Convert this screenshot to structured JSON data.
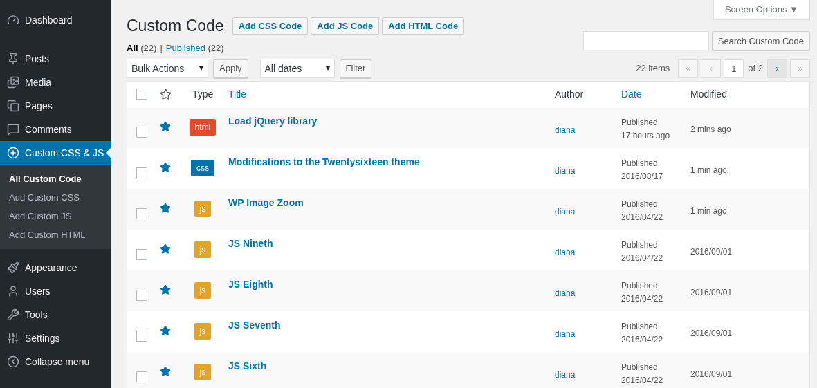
{
  "sidebar": {
    "items": [
      {
        "label": "Dashboard",
        "selected": false
      },
      {
        "label": "Posts",
        "selected": false
      },
      {
        "label": "Media",
        "selected": false
      },
      {
        "label": "Pages",
        "selected": false
      },
      {
        "label": "Comments",
        "selected": false
      },
      {
        "label": "Custom CSS & JS",
        "selected": true,
        "children": [
          {
            "label": "All Custom Code",
            "selected": true
          },
          {
            "label": "Add Custom CSS",
            "selected": false
          },
          {
            "label": "Add Custom JS",
            "selected": false
          },
          {
            "label": "Add Custom HTML",
            "selected": false
          }
        ]
      },
      {
        "label": "Appearance",
        "selected": false
      },
      {
        "label": "Users",
        "selected": false
      },
      {
        "label": "Tools",
        "selected": false
      },
      {
        "label": "Settings",
        "selected": false
      },
      {
        "label": "Collapse menu",
        "selected": false
      }
    ]
  },
  "header": {
    "title": "Custom Code",
    "add_buttons": [
      "Add CSS Code",
      "Add JS Code",
      "Add HTML Code"
    ],
    "screen_options": "Screen Options ▼"
  },
  "views": [
    {
      "label": "All",
      "count": "(22)",
      "selected": true
    },
    {
      "label": "Published",
      "count": "(22)",
      "selected": false
    }
  ],
  "views_separator": "|",
  "search": {
    "button": "Search Custom Code"
  },
  "filters": {
    "bulk_action": "Bulk Actions",
    "apply": "Apply",
    "date": "All dates",
    "filter": "Filter"
  },
  "pagination": {
    "count": "22 items",
    "buttons": [
      {
        "label": "«",
        "disabled": true
      },
      {
        "label": "‹",
        "disabled": true
      }
    ],
    "page": "1",
    "of": "of 2",
    "next_buttons": [
      {
        "label": "›",
        "disabled": false
      },
      {
        "label": "»",
        "disabled": true
      }
    ]
  },
  "table": {
    "select_all_checked": false,
    "columns": [
      {
        "label": "Type",
        "link": false
      },
      {
        "label": "Title",
        "link": true
      },
      {
        "label": "Author",
        "link": false
      },
      {
        "label": "Date",
        "link": true
      },
      {
        "label": "Modified",
        "link": false
      }
    ],
    "rows": [
      {
        "type": "html",
        "color": "#e14d2a",
        "title": "Load jQuery library",
        "author": "diana",
        "status": "Published",
        "date": "17 hours ago",
        "modified": "2 mins ago",
        "checked": false,
        "starred": true
      },
      {
        "type": "css",
        "color": "#0073aa",
        "title": "Modifications to the Twentysixteen theme",
        "author": "diana",
        "status": "Published",
        "date": "2016/08/17",
        "modified": "1 min ago",
        "checked": false,
        "starred": true
      },
      {
        "type": "js",
        "color": "#e3a229",
        "title": "WP Image Zoom",
        "author": "diana",
        "status": "Published",
        "date": "2016/04/22",
        "modified": "1 min ago",
        "checked": false,
        "starred": true
      },
      {
        "type": "js",
        "color": "#e3a229",
        "title": "JS Nineth",
        "author": "diana",
        "status": "Published",
        "date": "2016/04/22",
        "modified": "2016/09/01",
        "checked": false,
        "starred": true
      },
      {
        "type": "js",
        "color": "#e3a229",
        "title": "JS Eighth",
        "author": "diana",
        "status": "Published",
        "date": "2016/04/22",
        "modified": "2016/09/01",
        "checked": false,
        "starred": true
      },
      {
        "type": "js",
        "color": "#e3a229",
        "title": "JS Seventh",
        "author": "diana",
        "status": "Published",
        "date": "2016/04/22",
        "modified": "2016/09/01",
        "checked": false,
        "starred": true
      },
      {
        "type": "js",
        "color": "#e3a229",
        "title": "JS Sixth",
        "author": "diana",
        "status": "Published",
        "date": "2016/04/22",
        "modified": "2016/09/01",
        "checked": false,
        "starred": true
      }
    ]
  }
}
